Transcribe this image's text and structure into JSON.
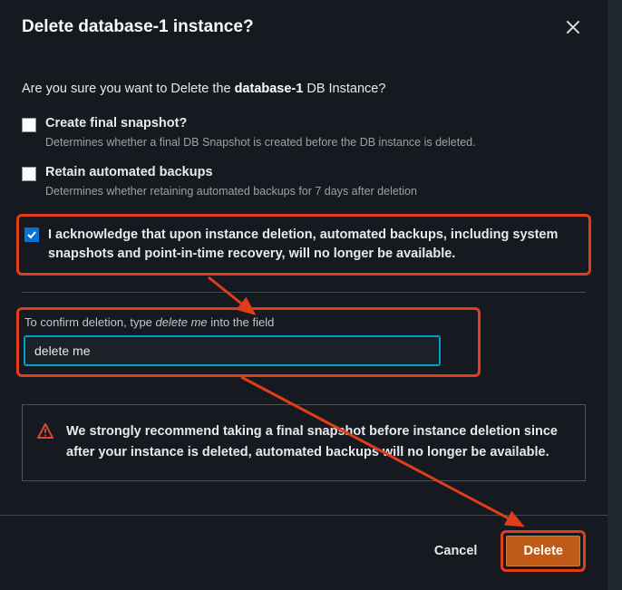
{
  "header": {
    "title": "Delete database-1 instance?"
  },
  "body": {
    "confirm_q_pre": "Are you sure you want to Delete the ",
    "confirm_q_bold": "database-1",
    "confirm_q_post": " DB Instance?",
    "snapshot": {
      "label": "Create final snapshot?",
      "desc": "Determines whether a final DB Snapshot is created before the DB instance is deleted."
    },
    "retain": {
      "label": "Retain automated backups",
      "desc": "Determines whether retaining automated backups for 7 days after deletion"
    },
    "ack": {
      "text": "I acknowledge that upon instance deletion, automated backups, including system snapshots and point-in-time recovery, will no longer be available."
    },
    "confirm_input": {
      "instr_pre": "To confirm deletion, type ",
      "instr_italic": "delete me",
      "instr_post": " into the field",
      "value": "delete me"
    },
    "warning": {
      "text": "We strongly recommend taking a final snapshot before instance deletion since after your instance is deleted, automated backups will no longer be available."
    }
  },
  "footer": {
    "cancel": "Cancel",
    "delete": "Delete"
  }
}
